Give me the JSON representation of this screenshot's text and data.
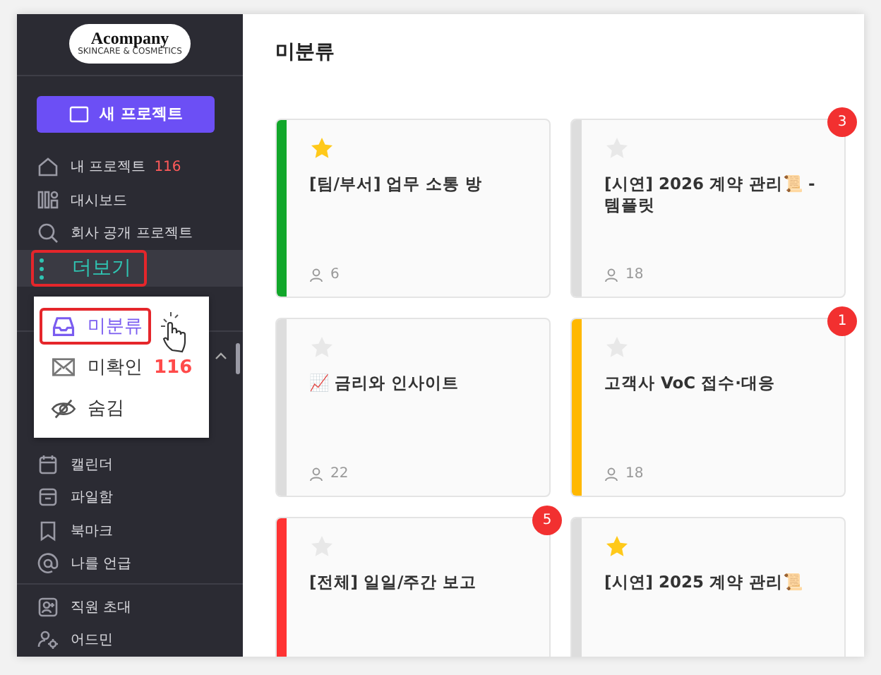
{
  "logo": {
    "name": "Acompany",
    "tagline": "SKINCARE & COSMETICS"
  },
  "new_project_button": "새 프로젝트",
  "nav": [
    {
      "label": "내 프로젝트",
      "count": "116"
    },
    {
      "label": "대시보드"
    },
    {
      "label": "회사 공개 프로젝트"
    }
  ],
  "more_menu": {
    "label": "더보기",
    "expanded": true,
    "items": [
      {
        "label": "미분류",
        "selected": true
      },
      {
        "label": "미확인",
        "count": "116",
        "selected": false
      },
      {
        "label": "숨김",
        "selected": false
      }
    ]
  },
  "nav_lower": [
    {
      "label": "캘린더"
    },
    {
      "label": "파일함"
    },
    {
      "label": "북마크"
    },
    {
      "label": "나를 언급"
    }
  ],
  "nav_bottom": [
    {
      "label": "직원 초대"
    },
    {
      "label": "어드민"
    }
  ],
  "page_title": "미분류",
  "cards": [
    {
      "title": "[팀/부서] 업무 소통 방",
      "color": "#11a72a",
      "starred": true,
      "members": "6"
    },
    {
      "title": "[시연] 2026 계약 관리📜 - 템플릿",
      "color": "#dddddd",
      "starred": false,
      "members": "18",
      "badge": "3"
    },
    {
      "title": "📈 금리와 인사이트",
      "color": "#dddddd",
      "starred": false,
      "members": "22"
    },
    {
      "title": "고객사 VoC 접수·대응",
      "color": "#ffb800",
      "starred": false,
      "members": "18",
      "badge": "1"
    },
    {
      "title": "[전체] 일일/주간 보고",
      "color": "#ff3333",
      "starred": false,
      "badge": "5"
    },
    {
      "title": "[시연] 2025 계약 관리📜",
      "color": "#dddddd",
      "starred": true
    }
  ]
}
